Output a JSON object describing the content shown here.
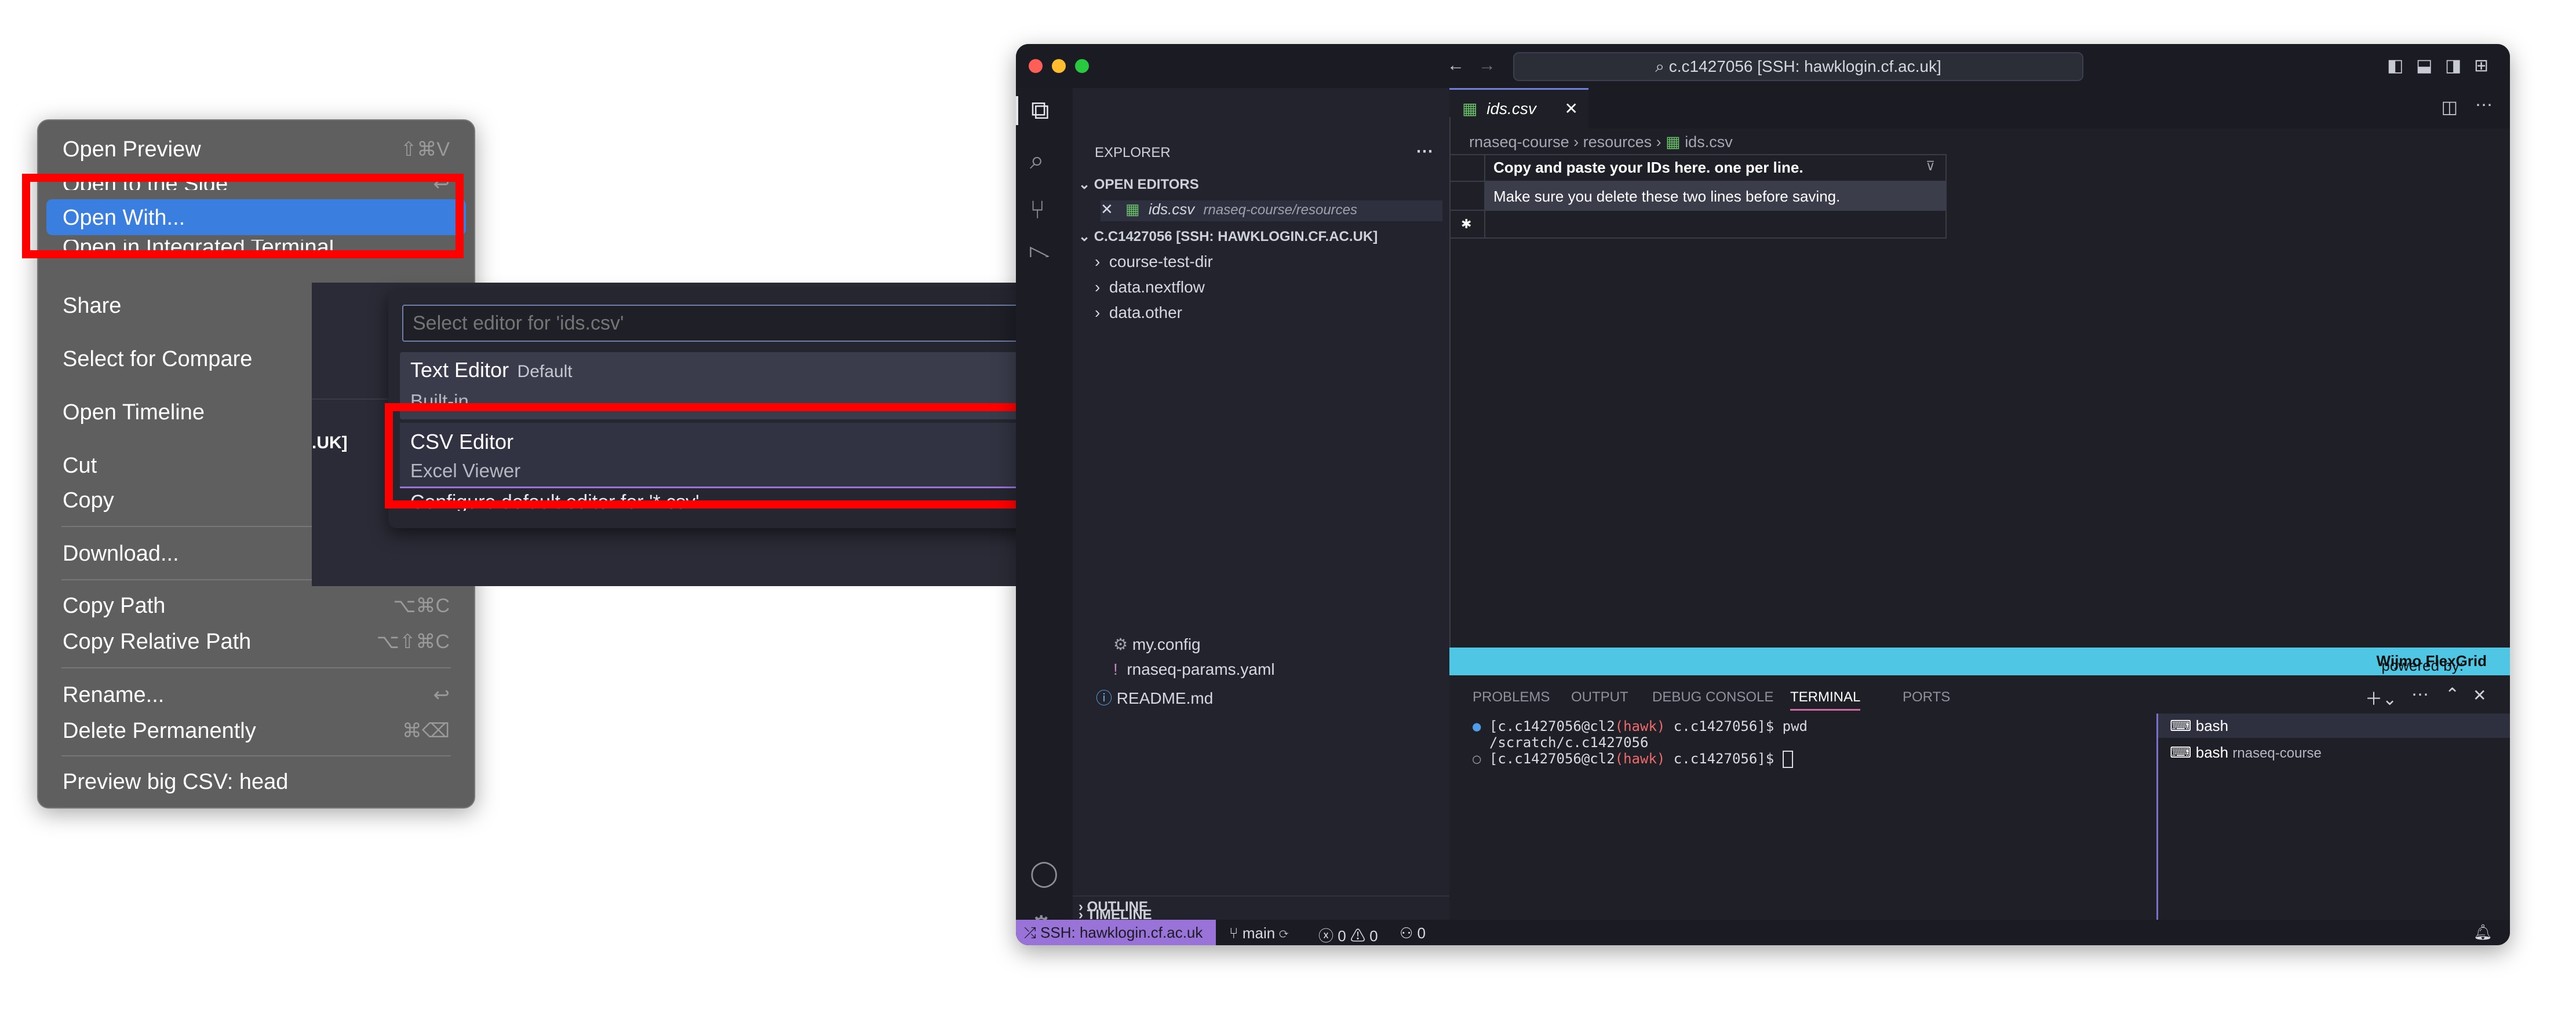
{
  "context_menu": {
    "items": [
      {
        "label": "Open Preview",
        "shortcut": "⇧⌘V"
      },
      {
        "label": "Open to the Side",
        "shortcut": "⌃↩"
      },
      {
        "label": "Open With...",
        "shortcut": ""
      },
      {
        "label": "Open in Integrated Terminal",
        "shortcut": ""
      },
      {
        "label": "Share",
        "shortcut": ""
      },
      {
        "label": "Select for Compare",
        "shortcut": ""
      },
      {
        "label": "Open Timeline",
        "shortcut": ""
      },
      {
        "label": "Cut",
        "shortcut": ""
      },
      {
        "label": "Copy",
        "shortcut": ""
      },
      {
        "label": "Download...",
        "shortcut": ""
      },
      {
        "label": "Copy Path",
        "shortcut": "⌥⌘C"
      },
      {
        "label": "Copy Relative Path",
        "shortcut": "⌥⇧⌘C"
      },
      {
        "label": "Rename...",
        "shortcut": "↩"
      },
      {
        "label": "Delete Permanently",
        "shortcut": "⌘⌫"
      },
      {
        "label": "Preview big CSV: head",
        "shortcut": ""
      }
    ]
  },
  "quick_pick": {
    "placeholder": "Select editor for 'ids.csv'",
    "background_fragment": ".UK]",
    "items": [
      {
        "title": "Text Editor",
        "badge": "Default",
        "detail": "Built-in"
      },
      {
        "title": "CSV Editor",
        "badge": "",
        "detail": "Excel Viewer"
      },
      {
        "title": "Configure default editor for '*.csv'...",
        "badge": "",
        "detail": ""
      }
    ]
  },
  "window": {
    "command_center": "c.c1427056 [SSH: hawklogin.cf.ac.uk]",
    "explorer_title": "EXPLORER",
    "open_editors_header": "OPEN EDITORS",
    "open_editor": {
      "name": "ids.csv",
      "path": "rnaseq-course/resources"
    },
    "workspace_header": "C.C1427056 [SSH: HAWKLOGIN.CF.AC.UK]",
    "tree_top": [
      "course-test-dir",
      "data.nextflow",
      "data.other"
    ],
    "tree_bottom": [
      "my.config",
      "rnaseq-params.yaml",
      "README.md"
    ],
    "outline": "OUTLINE",
    "timeline": "TIMELINE",
    "tab": "ids.csv",
    "breadcrumb": [
      "rnaseq-course",
      "resources",
      "ids.csv"
    ],
    "grid": {
      "header": "Copy and paste your IDs here. one per line.",
      "row1": "Make sure you delete these two lines before saving.",
      "new_row_marker": "✱"
    },
    "flexgrid": {
      "prefix": "powered by:",
      "brand": "Wijmo FlexGrid"
    },
    "panel_tabs": [
      "PROBLEMS",
      "OUTPUT",
      "DEBUG CONSOLE",
      "TERMINAL",
      "PORTS"
    ],
    "terminal_lines": [
      {
        "user": "[c.c1427056@cl2",
        "host": "(hawk)",
        "rest": " c.c1427056]$ pwd"
      },
      {
        "plain": "/scratch/c.c1427056"
      },
      {
        "user": "[c.c1427056@cl2",
        "host": "(hawk)",
        "rest": " c.c1427056]$ "
      }
    ],
    "terminals": [
      {
        "name": "bash",
        "detail": ""
      },
      {
        "name": "bash",
        "detail": "rnaseq-course"
      }
    ],
    "status": {
      "remote": "SSH: hawklogin.cf.ac.uk",
      "branch": "main",
      "errors": "0",
      "warnings": "0",
      "ports": "0"
    }
  },
  "colors": {
    "highlight": "#3a7ee0",
    "red_box": "#ff0000",
    "accent": "#9a73d8",
    "flex_bar": "#4fc6e3"
  }
}
